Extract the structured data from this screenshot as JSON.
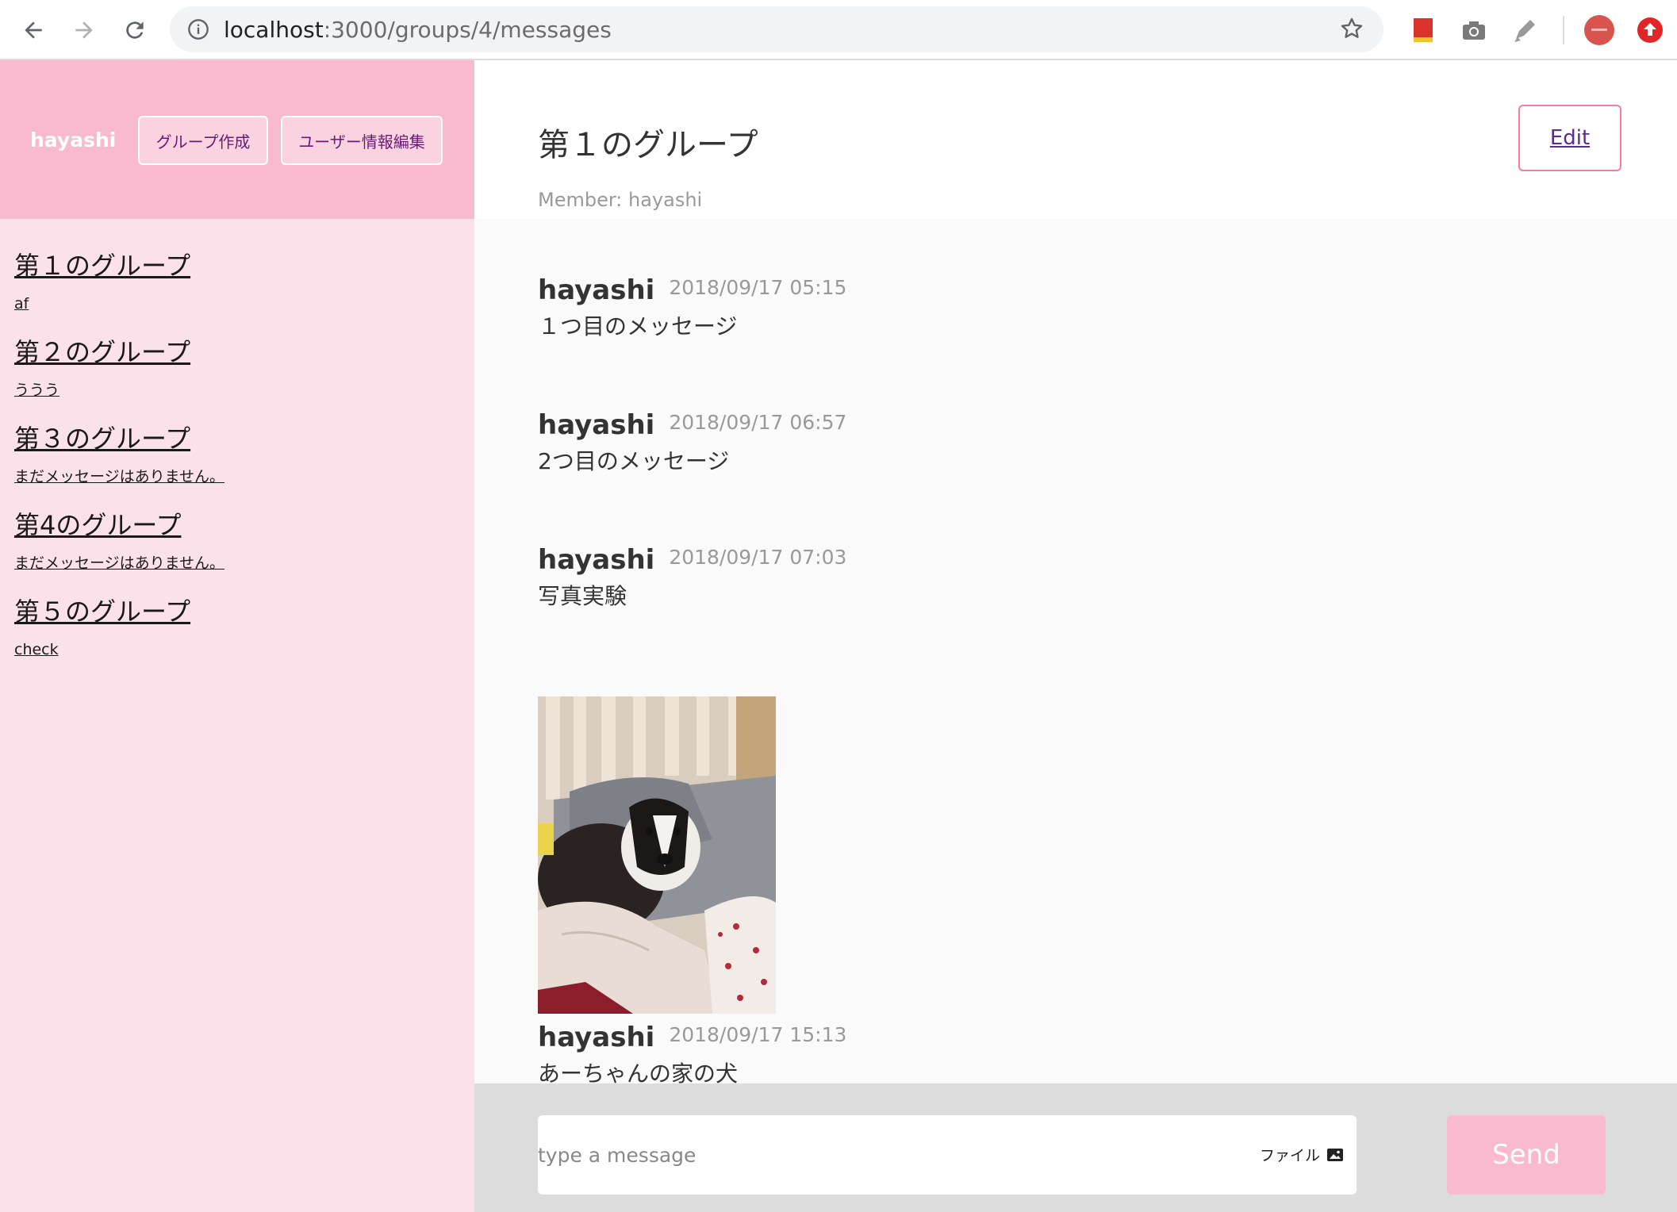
{
  "browser": {
    "url_host": "localhost",
    "url_path": ":3000/groups/4/messages"
  },
  "sidebar": {
    "user_name": "hayashi",
    "create_group_label": "グループ作成",
    "edit_user_label": "ユーザー情報編集",
    "groups": [
      {
        "name": "第１のグループ",
        "last": "af"
      },
      {
        "name": "第２のグループ",
        "last": "ううう"
      },
      {
        "name": "第３のグループ",
        "last": "まだメッセージはありません。"
      },
      {
        "name": "第4のグループ",
        "last": "まだメッセージはありません。"
      },
      {
        "name": "第５のグループ",
        "last": "check"
      }
    ]
  },
  "main": {
    "title": "第１のグループ",
    "members": "Member: hayashi",
    "edit_label": "Edit",
    "messages": [
      {
        "user": "hayashi",
        "date": "2018/09/17 05:15",
        "text": "１つ目のメッセージ"
      },
      {
        "user": "hayashi",
        "date": "2018/09/17 06:57",
        "text": "2つ目のメッセージ"
      },
      {
        "user": "hayashi",
        "date": "2018/09/17 07:03",
        "text": "写真実験"
      },
      {
        "user": "hayashi",
        "date": "2018/09/17 15:13",
        "text": "あーちゃんの家の犬"
      }
    ],
    "form": {
      "placeholder": "type a message",
      "file_label": "ファイル",
      "send_label": "Send"
    }
  },
  "colors": {
    "sidebar_header": "#f9bad0",
    "sidebar_bg": "#fbe1ea",
    "accent_border": "#f37ea5",
    "send_button": "#f9bad0"
  }
}
